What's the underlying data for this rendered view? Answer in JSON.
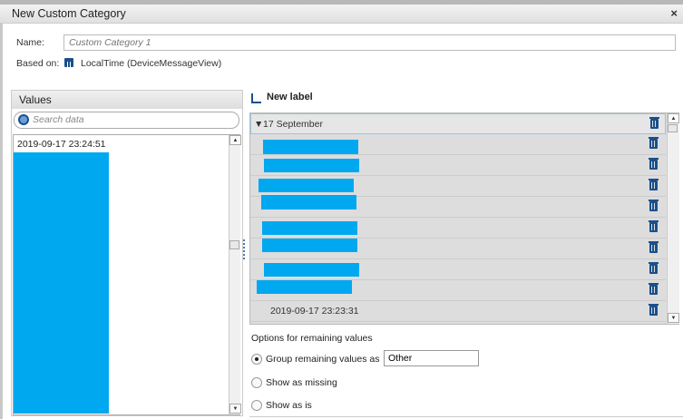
{
  "dialog": {
    "title": "New Custom Category",
    "close_icon": "×"
  },
  "form": {
    "name_label": "Name:",
    "name_placeholder": "Custom Category 1",
    "based_on_label": "Based on:",
    "based_on_value": "LocalTime (DeviceMessageView)",
    "source_icon": "column-icon"
  },
  "values": {
    "header": "Values",
    "search_placeholder": "Search data",
    "items": [
      "2019-09-17 23:24:51"
    ]
  },
  "labels": {
    "new_label": "New label",
    "group": "17 September",
    "visible_item": "2019-09-17 23:23:31"
  },
  "options": {
    "title": "Options for remaining values",
    "group_label": "Group remaining values as",
    "group_value": "Other",
    "missing_label": "Show as missing",
    "asis_label": "Show as is",
    "selected": "group"
  },
  "colors": {
    "redaction": "#00a8f0",
    "accent": "#1b4f8a"
  }
}
